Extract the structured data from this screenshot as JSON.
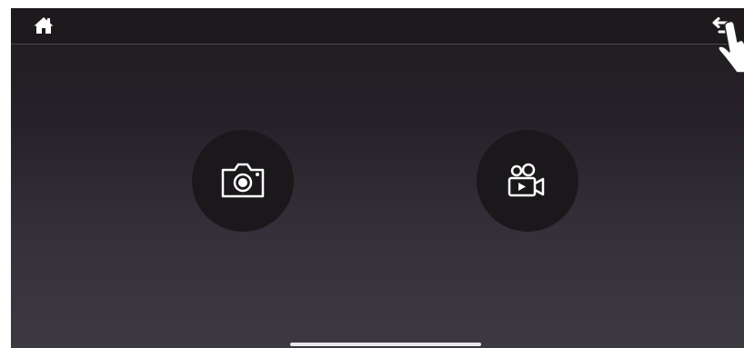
{
  "topbar": {
    "home_icon": "home-icon",
    "back_icon": "return-icon"
  },
  "main": {
    "buttons": [
      {
        "icon": "camera-icon",
        "action": "take-photo"
      },
      {
        "icon": "video-camera-icon",
        "action": "record-video"
      }
    ]
  },
  "overlay": {
    "pointer_icon": "hand-pointer-icon"
  },
  "colors": {
    "background_top": "#1f1b1f",
    "background_bottom": "#3c3941",
    "button_fill": "#1b181c",
    "icon": "#ffffff"
  }
}
